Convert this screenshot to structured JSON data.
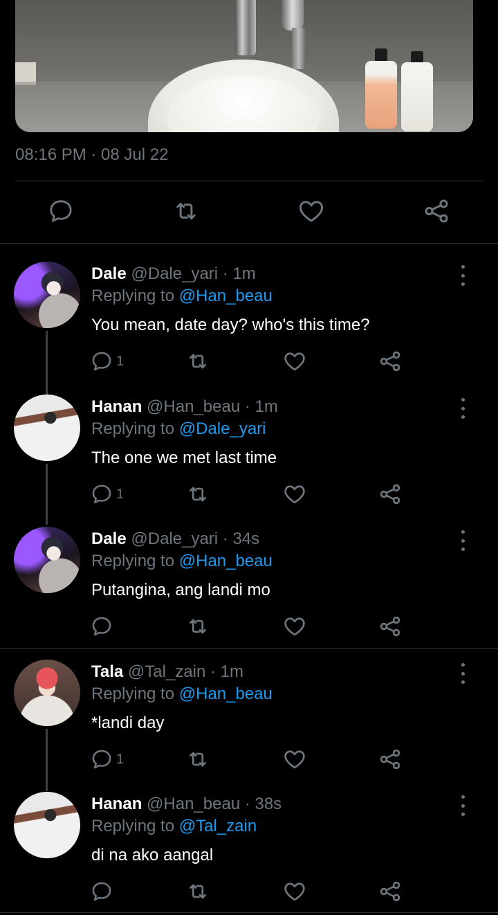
{
  "post": {
    "timestamp": "08:16 PM · 08 Jul 22"
  },
  "icons": {
    "reply": "speech-bubble-icon",
    "retweet": "retweet-arrows-icon",
    "like": "heart-icon",
    "share": "share-nodes-icon",
    "more": "vertical-ellipsis-icon"
  },
  "colors": {
    "background": "#000000",
    "muted": "#6e767d",
    "link": "#1d9bf0",
    "divider": "#2f3336"
  },
  "replies": [
    {
      "name": "Dale",
      "meta": "@Dale_yari · 1m",
      "replying_prefix": "Replying to",
      "replying_handle": "@Han_beau",
      "text": "You mean, date day? who's this time?",
      "reply_count": "1"
    },
    {
      "name": "Hanan",
      "meta": "@Han_beau · 1m",
      "replying_prefix": "Replying to",
      "replying_handle": "@Dale_yari",
      "text": "The one we met last time",
      "reply_count": "1"
    },
    {
      "name": "Dale",
      "meta": "@Dale_yari · 34s",
      "replying_prefix": "Replying to",
      "replying_handle": "@Han_beau",
      "text": "Putangina, ang landi mo",
      "reply_count": ""
    },
    {
      "name": "Tala",
      "meta": "@Tal_zain · 1m",
      "replying_prefix": "Replying to",
      "replying_handle": "@Han_beau",
      "text": "*landi day",
      "reply_count": "1"
    },
    {
      "name": "Hanan",
      "meta": "@Han_beau · 38s",
      "replying_prefix": "Replying to",
      "replying_handle": "@Tal_zain",
      "text": "di na ako aangal",
      "reply_count": ""
    }
  ]
}
